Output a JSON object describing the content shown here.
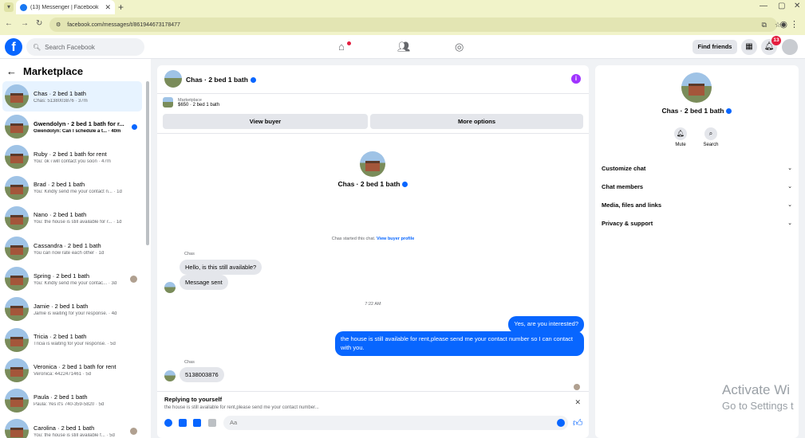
{
  "browser": {
    "tab_title": "(13) Messenger | Facebook",
    "url": "facebook.com/messages/t/861944673178477"
  },
  "header": {
    "search_placeholder": "Search Facebook",
    "find_friends": "Find friends",
    "notif_count": "13"
  },
  "sidebar": {
    "title": "Marketplace",
    "conversations": [
      {
        "name": "Chas · 2 bed 1 bath",
        "preview": "Chas: 5138003876 · 37m",
        "unread": false,
        "active": true
      },
      {
        "name": "Gwendolyn · 2 bed 1 bath for r...",
        "preview": "Gwendolyn: Can I schedule a t... · 40m",
        "unread": true,
        "active": false
      },
      {
        "name": "Ruby · 2 bed 1 bath for rent",
        "preview": "You: ok i will contact you soon · 47m",
        "unread": false,
        "active": false
      },
      {
        "name": "Brad · 2 bed 1 bath",
        "preview": "You: Kindly send me your contact n... · 1d",
        "unread": false,
        "active": false
      },
      {
        "name": "Nano · 2 bed 1 bath",
        "preview": "You: the house is still available for r... · 1d",
        "unread": false,
        "active": false
      },
      {
        "name": "Cassandra · 2 bed 1 bath",
        "preview": "You can now rate each other · 1d",
        "unread": false,
        "active": false
      },
      {
        "name": "Spring · 2 bed 1 bath",
        "preview": "You: Kindly send me your contac... · 3d",
        "unread": false,
        "active": false
      },
      {
        "name": "Jamie · 2 bed 1 bath",
        "preview": "Jamie is waiting for your response. · 4d",
        "unread": false,
        "active": false
      },
      {
        "name": "Tricia · 2 bed 1 bath",
        "preview": "Tricia is waiting for your response. · 5d",
        "unread": false,
        "active": false
      },
      {
        "name": "Veronica · 2 bed 1 bath for rent",
        "preview": "Veronica: 4422471461 · 5d",
        "unread": false,
        "active": false
      },
      {
        "name": "Paula · 2 bed 1 bath",
        "preview": "Paula: Yes it's 740-359-5820 · 5d",
        "unread": false,
        "active": false
      },
      {
        "name": "Carolina · 2 bed 1 bath",
        "preview": "You: the house is still available f... · 5d",
        "unread": false,
        "active": false
      }
    ]
  },
  "chat": {
    "title": "Chas · 2 bed 1 bath",
    "marketplace_label": "Marketplace",
    "listing": "$650 · 2 bed 1 bath",
    "view_buyer": "View buyer",
    "more_options": "More options",
    "center_name": "Chas · 2 bed 1 bath",
    "started_text": "Chas started this chat.",
    "view_buyer_profile": "View buyer profile",
    "sender_name": "Chas",
    "msg1": "Hello, is this still available?",
    "msg2": "Message sent",
    "time": "7:22 AM",
    "out1": "Yes, are you interested?",
    "out2": "the house is still available for rent,please send me your contact number so I can contact with you.",
    "sender_name2": "Chas",
    "msg3": "5138003876",
    "reply_title": "Replying to yourself",
    "reply_text": "the house is still available for rent,please send me your contact number...",
    "composer_placeholder": "Aa"
  },
  "right_panel": {
    "name": "Chas · 2 bed 1 bath",
    "mute": "Mute",
    "search": "Search",
    "items": [
      "Customize chat",
      "Chat members",
      "Media, files and links",
      "Privacy & support"
    ]
  },
  "watermark": {
    "line1": "Activate Wi",
    "line2": "Go to Settings t"
  },
  "colors": {
    "accent": "#0866ff",
    "unread": "#0866ff",
    "badge": "#e41e3f"
  }
}
